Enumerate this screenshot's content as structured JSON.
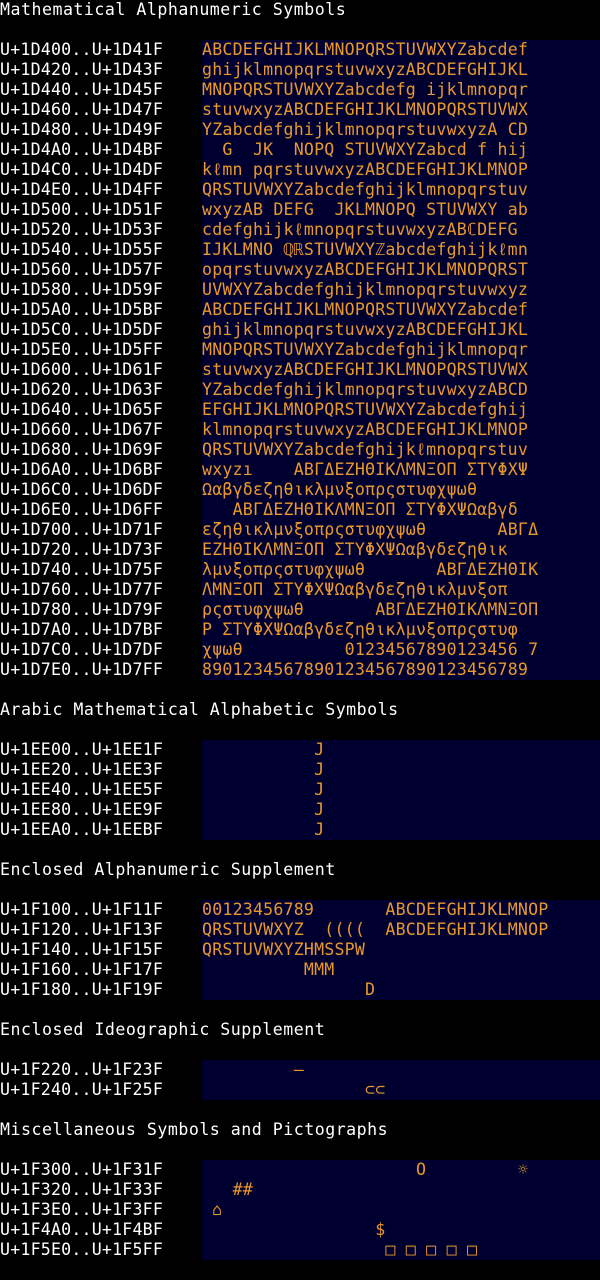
{
  "colors": {
    "background": "#000000",
    "heading": "#ffffff",
    "glyph": "#e8982a",
    "cell_background": "#000030"
  },
  "sections": [
    {
      "title": "Mathematical Alphanumeric Symbols",
      "rows": [
        {
          "range": "U+1D400..U+1D41F",
          "glyphs": "ABCDEFGHIJKLMNOPQRSTUVWXYZabcdef"
        },
        {
          "range": "U+1D420..U+1D43F",
          "glyphs": "ghijklmnopqrstuvwxyzABCDEFGHIJKL"
        },
        {
          "range": "U+1D440..U+1D45F",
          "glyphs": "MNOPQRSTUVWXYZabcdefg ijklmnopqr"
        },
        {
          "range": "U+1D460..U+1D47F",
          "glyphs": "stuvwxyzABCDEFGHIJKLMNOPQRSTUVWX"
        },
        {
          "range": "U+1D480..U+1D49F",
          "glyphs": "YZabcdefghijklmnopqrstuvwxyzA CD"
        },
        {
          "range": "U+1D4A0..U+1D4BF",
          "glyphs": "  G  JK  NOPQ STUVWXYZabcd f hij"
        },
        {
          "range": "U+1D4C0..U+1D4DF",
          "glyphs": "kℓmn pqrstuvwxyzABCDEFGHIJKLMNOP"
        },
        {
          "range": "U+1D4E0..U+1D4FF",
          "glyphs": "QRSTUVWXYZabcdefghijklmnopqrstuv"
        },
        {
          "range": "U+1D500..U+1D51F",
          "glyphs": "wxyzAB DEFG  JKLMNOPQ STUVWXY ab"
        },
        {
          "range": "U+1D520..U+1D53F",
          "glyphs": "cdefghijkℓmnopqrstuvwxyzABℂDEFG "
        },
        {
          "range": "U+1D540..U+1D55F",
          "glyphs": "IJKLMNO ℚℝSTUVWXYℤabcdefghijkℓmn"
        },
        {
          "range": "U+1D560..U+1D57F",
          "glyphs": "opqrstuvwxyzABCDEFGHIJKLMNOPQRST"
        },
        {
          "range": "U+1D580..U+1D59F",
          "glyphs": "UVWXYZabcdefghijklmnopqrstuvwxyz"
        },
        {
          "range": "U+1D5A0..U+1D5BF",
          "glyphs": "ABCDEFGHIJKLMNOPQRSTUVWXYZabcdef"
        },
        {
          "range": "U+1D5C0..U+1D5DF",
          "glyphs": "ghijklmnopqrstuvwxyzABCDEFGHIJKL"
        },
        {
          "range": "U+1D5E0..U+1D5FF",
          "glyphs": "MNOPQRSTUVWXYZabcdefghijklmnopqr"
        },
        {
          "range": "U+1D600..U+1D61F",
          "glyphs": "stuvwxyzABCDEFGHIJKLMNOPQRSTUVWX"
        },
        {
          "range": "U+1D620..U+1D63F",
          "glyphs": "YZabcdefghijklmnopqrstuvwxyzABCD"
        },
        {
          "range": "U+1D640..U+1D65F",
          "glyphs": "EFGHIJKLMNOPQRSTUVWXYZabcdefghij"
        },
        {
          "range": "U+1D660..U+1D67F",
          "glyphs": "klmnopqrstuvwxyzABCDEFGHIJKLMNOP"
        },
        {
          "range": "U+1D680..U+1D69F",
          "glyphs": "QRSTUVWXYZabcdefghijkℓmnopqrstuv"
        },
        {
          "range": "U+1D6A0..U+1D6BF",
          "glyphs": "wxyzı    ΑΒΓΔΕΖΗΘΙΚΛΜΝΞΟΠ ΣΤΥΦΧΨ"
        },
        {
          "range": "U+1D6C0..U+1D6DF",
          "glyphs": "Ωαβγδεζηθικλμνξοπρςστυφχψωθ     "
        },
        {
          "range": "U+1D6E0..U+1D6FF",
          "glyphs": "   ΑΒΓΔΕΖΗΘΙΚΛΜΝΞΟΠ ΣΤΥΦΧΨΩαβγδ"
        },
        {
          "range": "U+1D700..U+1D71F",
          "glyphs": "εζηθικλμνξοπρςστυφχψωθ       ΑΒΓΔ"
        },
        {
          "range": "U+1D720..U+1D73F",
          "glyphs": "ΕΖΗΘΙΚΛΜΝΞΟΠ ΣΤΥΦΧΨΩαβγδεζηθικ"
        },
        {
          "range": "U+1D740..U+1D75F",
          "glyphs": "λμνξοπρςστυφχψωθ       ΑΒΓΔΕΖΗΘΙΚ"
        },
        {
          "range": "U+1D760..U+1D77F",
          "glyphs": "ΛΜΝΞΟΠ ΣΤΥΦΧΨΩαβγδεζηθικλμνξοπ"
        },
        {
          "range": "U+1D780..U+1D79F",
          "glyphs": "ρςστυφχψωθ       ΑΒΓΔΕΖΗΘΙΚΛΜΝΞΟΠ"
        },
        {
          "range": "U+1D7A0..U+1D7BF",
          "glyphs": "Ρ ΣΤΥΦΧΨΩαβγδεζηθικλμνξοπρςστυφ"
        },
        {
          "range": "U+1D7C0..U+1D7DF",
          "glyphs": "χψωθ          01234567890123456 7"
        },
        {
          "range": "U+1D7E0..U+1D7FF",
          "glyphs": "89012345678901234567890123456789"
        }
      ]
    },
    {
      "title": "Arabic Mathematical Alphabetic Symbols",
      "rows": [
        {
          "range": "U+1EE00..U+1EE1F",
          "glyphs": "           J"
        },
        {
          "range": "U+1EE20..U+1EE3F",
          "glyphs": "           J"
        },
        {
          "range": "U+1EE40..U+1EE5F",
          "glyphs": "           J"
        },
        {
          "range": "U+1EE80..U+1EE9F",
          "glyphs": "           J"
        },
        {
          "range": "U+1EEA0..U+1EEBF",
          "glyphs": "           J"
        }
      ]
    },
    {
      "title": "Enclosed Alphanumeric Supplement",
      "rows": [
        {
          "range": "U+1F100..U+1F11F",
          "glyphs": "00123456789       ABCDEFGHIJKLMNOP"
        },
        {
          "range": "U+1F120..U+1F13F",
          "glyphs": "QRSTUVWXYZ  ((((  ABCDEFGHIJKLMNOP"
        },
        {
          "range": "U+1F140..U+1F15F",
          "glyphs": "QRSTUVWXYZHMSSPW"
        },
        {
          "range": "U+1F160..U+1F17F",
          "glyphs": "          MMM"
        },
        {
          "range": "U+1F180..U+1F19F",
          "glyphs": "                D"
        }
      ]
    },
    {
      "title": "Enclosed Ideographic Supplement",
      "rows": [
        {
          "range": "U+1F220..U+1F23F",
          "glyphs": "         –"
        },
        {
          "range": "U+1F240..U+1F25F",
          "glyphs": "                ⊂⊂"
        }
      ]
    },
    {
      "title": "Miscellaneous Symbols and Pictographs",
      "rows": [
        {
          "range": "U+1F300..U+1F31F",
          "glyphs": "                     O         ☼"
        },
        {
          "range": "U+1F320..U+1F33F",
          "glyphs": "   ##"
        },
        {
          "range": "U+1F3E0..U+1F3FF",
          "glyphs": " ⌂"
        },
        {
          "range": "U+1F4A0..U+1F4BF",
          "glyphs": "                 $"
        },
        {
          "range": "U+1F5E0..U+1F5FF",
          "glyphs": "                  □ □ □ □ □"
        }
      ]
    }
  ]
}
